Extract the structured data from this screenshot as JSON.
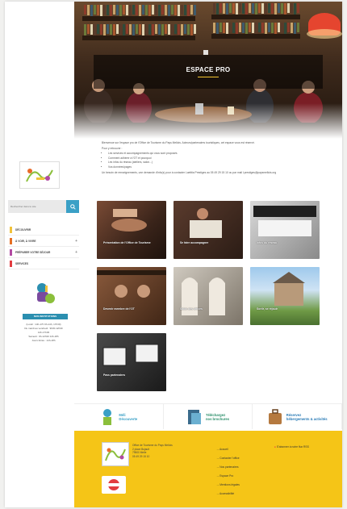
{
  "hero": {
    "title": "ESPACE PRO"
  },
  "intro": {
    "welcome": "Bienvenue sur l'espace pro de l'Office de Tourisme du Pays Mellois. Acteurs/partenaires touristiques, cet espace vous est réservé.",
    "heading": "Pour y retrouver :",
    "bullets": [
      "Les services et accompagnements qui vous sont proposés",
      "Comment adhérer à l'OT et pourquoi",
      "Les infos du réseau (ateliers, salon...)",
      "Vos données/pages"
    ],
    "contact": "Un besoin de renseignements, une demande d'info(s) pour à contacter Laetitia Prestiges au 05 49 29 15 10 ou par mail l.prestiges@paysmellois.org"
  },
  "sidebar": {
    "search_placeholder": "Rechercher dans le site",
    "nav": [
      {
        "label": "DÉCOUVRIR",
        "color": "#f1c23b",
        "has_plus": false
      },
      {
        "label": "À VOIR, À VIVRE",
        "color": "#e66f23",
        "has_plus": true
      },
      {
        "label": "PRÉPARER VOTRE SÉJOUR",
        "color": "#b24aa2",
        "has_plus": true
      },
      {
        "label": "SERVICES",
        "color": "#e23c40",
        "has_plus": false
      }
    ],
    "button": "NOS INSTITUTIONS",
    "info_lines": [
      "(Lundi : 14h-17h 9h-14h, 17h30)",
      "Du mardi au vendredi : 9h30-12h30",
      "14h-17h30",
      "Samedi : 9h-12h30 14h-18h",
      "Jours fériés : 14h-18h"
    ]
  },
  "tiles": [
    {
      "caption": "Présentation de l'Office de Tourisme"
    },
    {
      "caption": "Se faire accompagner"
    },
    {
      "caption": "Infos du réseau"
    },
    {
      "caption": "Devenir membre de l'OT"
    },
    {
      "caption": "Salon des offices"
    },
    {
      "caption": "Sortir, se réjouir"
    },
    {
      "caption": "Pass partenaires"
    }
  ],
  "banners": [
    {
      "label_line1": "Méli",
      "label_line2": "Découverte",
      "color": "#3aa0c6"
    },
    {
      "label_line1": "Téléchargez",
      "label_line2": "nos brochures",
      "color": "#2b8f6a"
    },
    {
      "label_line1": "Réservez",
      "label_line2": "hébergements & activités",
      "color": "#2a7bb6"
    }
  ],
  "footer": {
    "address_lines": [
      "Office de Tourisme du Pays Mellois",
      "2 place Bujault",
      "79500 Melle",
      "",
      "05 49 29 15 10"
    ],
    "links": [
      "Accueil",
      "Contacter l'office",
      "Nos partenaires",
      "Espace Pro",
      "Mentions légales",
      "Accessibilité"
    ],
    "newsletter": "S'abonner à notre flux RSS"
  }
}
